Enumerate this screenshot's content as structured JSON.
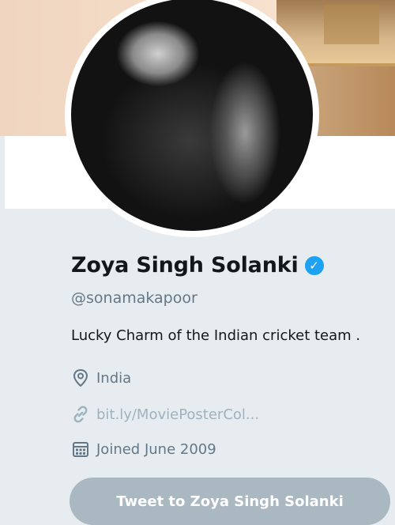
{
  "profile": {
    "name": "Zoya Singh Solanki",
    "handle": "@sonamakapoor",
    "bio": "Lucky Charm of the Indian cricket team .",
    "location": "India",
    "link": "bit.ly/MoviePosterCol...",
    "joined": "Joined June 2009",
    "verified_icon": "verified-badge-icon"
  },
  "actions": {
    "tweet_to_label": "Tweet to Zoya Singh Solanki"
  },
  "colors": {
    "accent": "#1da1f2",
    "background": "#e6ecf0",
    "muted_text": "#657786",
    "button_disabled": "#aab8c2"
  }
}
